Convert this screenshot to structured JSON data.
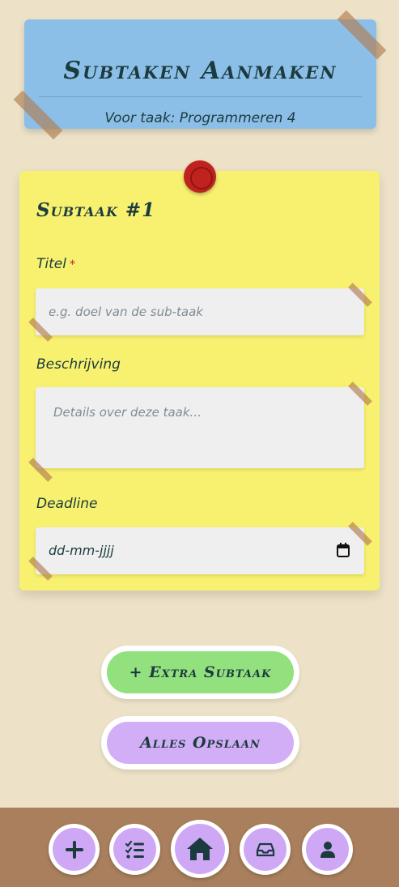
{
  "header": {
    "title": "Subtaken Aanmaken",
    "subtitle": "Voor taak: Programmeren 4"
  },
  "subtask": {
    "heading": "Subtaak #1",
    "title_label": "Titel",
    "required_marker": "*",
    "title_placeholder": "e.g. doel van de sub-taak",
    "description_label": "Beschrijving",
    "description_placeholder": "Details over deze taak...",
    "deadline_label": "Deadline",
    "deadline_value": "dd-mm-jjjj"
  },
  "actions": {
    "add_subtask": "+ Extra Subtaak",
    "save_all": "Alles Opslaan"
  },
  "nav": {
    "items": [
      {
        "icon": "plus-icon"
      },
      {
        "icon": "list-check-icon"
      },
      {
        "icon": "home-icon"
      },
      {
        "icon": "inbox-icon"
      },
      {
        "icon": "user-icon"
      }
    ]
  },
  "colors": {
    "background": "#ede2c8",
    "header_note": "#8cbfe8",
    "card_note": "#f8f16f",
    "pin": "#c0231e",
    "button_green": "#93e07f",
    "button_purple": "#d2aef7",
    "nav_bar": "#a97f5d",
    "nav_button": "#cfa8f5",
    "text": "#1c3b3e"
  }
}
